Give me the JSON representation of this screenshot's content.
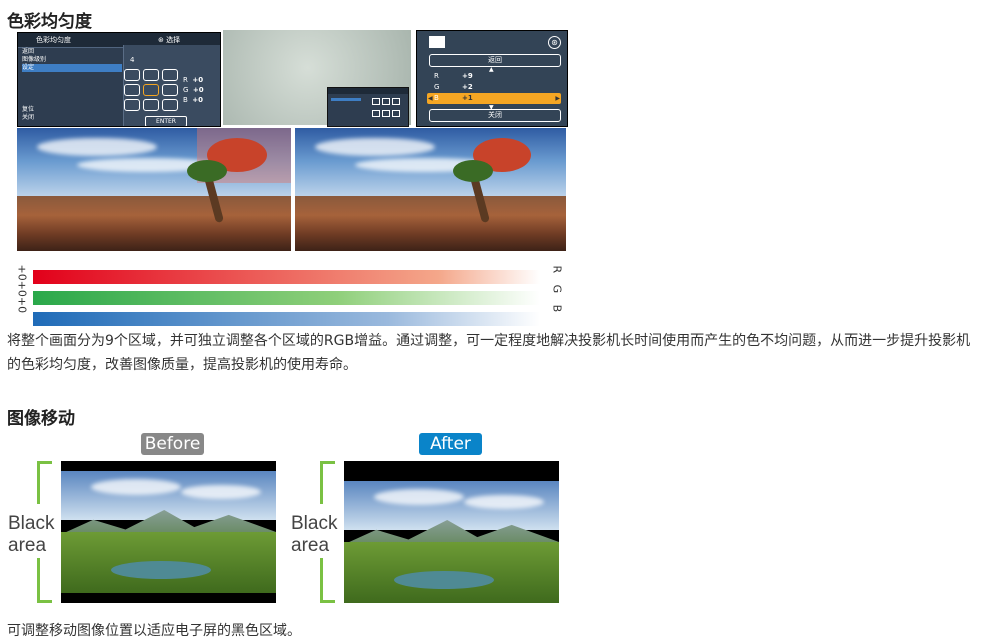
{
  "section1": {
    "heading": "色彩均匀度",
    "osd_left": {
      "title": "色彩均匀度",
      "title_right": "选择",
      "menu": [
        "返回",
        "图像级别",
        "设定"
      ],
      "menu_bottom": [
        "复位",
        "关闭"
      ],
      "grid_value": "4",
      "rgb": [
        {
          "label": "R",
          "value": "+0"
        },
        {
          "label": "G",
          "value": "+0"
        },
        {
          "label": "B",
          "value": "+0"
        }
      ],
      "enter_label": "ENTER"
    },
    "osd_right": {
      "back_label": "返回",
      "rgb": [
        {
          "label": "R",
          "value": "+9"
        },
        {
          "label": "G",
          "value": "+2"
        },
        {
          "label": "B",
          "value": "+1"
        }
      ],
      "close_label": "关闭"
    },
    "bars": {
      "left_labels": "+0+0+0",
      "right_labels": "R G B",
      "colors": [
        "#e2001a",
        "#2aa84a",
        "#1f6bb8"
      ]
    },
    "paragraph": "将整个画面分为9个区域，并可独立调整各个区域的RGB增益。通过调整，可一定程度地解决投影机长时间使用而产生的色不均问题，从而进一步提升投影机的色彩均匀度，改善图像质量，提高投影机的使用寿命。"
  },
  "section2": {
    "heading": "图像移动",
    "before_label": "Before",
    "after_label": "After",
    "black_area_line1": "Black",
    "black_area_line2": "area",
    "before_color": "#888888",
    "after_color": "#0a84c9",
    "caption": "可调整移动图像位置以适应电子屏的黑色区域。"
  }
}
